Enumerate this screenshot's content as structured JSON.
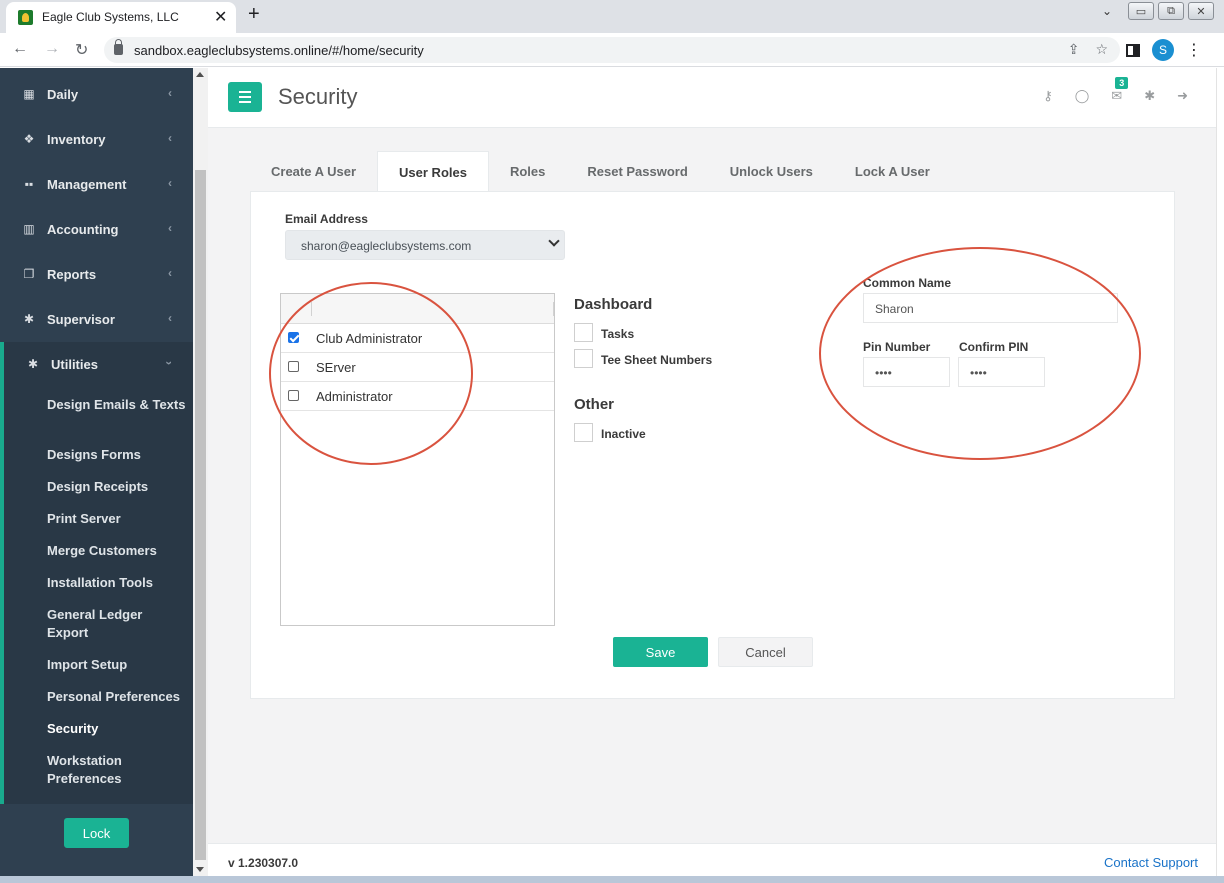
{
  "browser": {
    "tab_title": "Eagle Club Systems, LLC",
    "tab_close": "✕",
    "new_tab": "+",
    "url": "sandbox.eagleclubsystems.online/#/home/security",
    "profile_initial": "S"
  },
  "sidebar": {
    "items": [
      {
        "label": "Daily",
        "icon": "calendar-icon"
      },
      {
        "label": "Inventory",
        "icon": "cubes-icon"
      },
      {
        "label": "Management",
        "icon": "grid-icon"
      },
      {
        "label": "Accounting",
        "icon": "bar-chart-icon"
      },
      {
        "label": "Reports",
        "icon": "copy-icon"
      },
      {
        "label": "Supervisor",
        "icon": "gear-icon"
      },
      {
        "label": "Utilities",
        "icon": "gear-icon"
      }
    ],
    "sub_items": [
      "Design Emails & Texts",
      "Designs Forms",
      "Design Receipts",
      "Print Server",
      "Merge Customers",
      "Installation Tools",
      "General Ledger Export",
      "Import Setup",
      "Personal Preferences",
      "Security",
      "Workstation Preferences"
    ],
    "lock_label": "Lock"
  },
  "header": {
    "title": "Security",
    "mail_count": "3"
  },
  "tabs": [
    "Create A User",
    "User Roles",
    "Roles",
    "Reset Password",
    "Unlock Users",
    "Lock A User"
  ],
  "form": {
    "email_label": "Email Address",
    "email_value": "sharon@eagleclubsystems.com",
    "roles": [
      {
        "label": "Club Administrator",
        "checked": true
      },
      {
        "label": "SErver",
        "checked": false
      },
      {
        "label": "Administrator",
        "checked": false
      }
    ],
    "dashboard_title": "Dashboard",
    "dashboard_items": [
      "Tasks",
      "Tee Sheet Numbers"
    ],
    "other_title": "Other",
    "other_items": [
      "Inactive"
    ],
    "common_name_label": "Common Name",
    "common_name_value": "Sharon",
    "pin_label": "Pin Number",
    "pin_value": "••••",
    "confirm_pin_label": "Confirm PIN",
    "confirm_pin_value": "••••",
    "save_label": "Save",
    "cancel_label": "Cancel"
  },
  "footer": {
    "version": "v 1.230307.0",
    "support": "Contact Support"
  },
  "colors": {
    "accent": "#1ab394",
    "sidebar": "#2f4050",
    "annotation": "#d9533f"
  }
}
